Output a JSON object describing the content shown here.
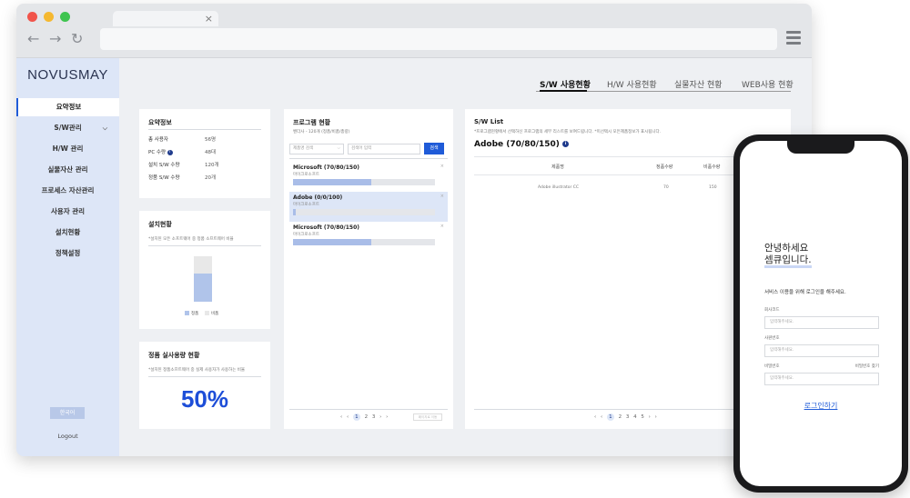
{
  "browser": {
    "tab_close": "×",
    "back": "←",
    "forward": "→",
    "reload": "↻"
  },
  "sidebar": {
    "logo": "NOVUSMAY",
    "items": [
      {
        "label": "요약정보"
      },
      {
        "label": "S/W관리"
      },
      {
        "label": "H/W 관리"
      },
      {
        "label": "실물자산 관리"
      },
      {
        "label": "프로세스 자산관리"
      },
      {
        "label": "사용자 관리"
      },
      {
        "label": "설치현황"
      },
      {
        "label": "정책설정"
      }
    ],
    "chevron": "⌵",
    "lang_button": "한국어",
    "logout": "Logout"
  },
  "top_tabs": [
    "S/W 사용현황",
    "H/W 사용현황",
    "실물자산 현황",
    "WEB사용 현황"
  ],
  "summary": {
    "title": "요약정보",
    "rows": [
      {
        "label": "총 사용자",
        "value": "56명"
      },
      {
        "label": "PC 수량",
        "value": "48대"
      },
      {
        "label": "설치 S/W 수량",
        "value": "120개"
      },
      {
        "label": "정품 S/W 수량",
        "value": "20개"
      }
    ],
    "info": "i"
  },
  "install": {
    "title": "설치현황",
    "subtitle": "*설치된 모든 소프트웨어 중 정품 소프트웨어 비율",
    "legend_genuine": "정품",
    "legend_other": "비품",
    "genuine_ratio": 0.62
  },
  "usage": {
    "title": "정품 실사용량 현황",
    "subtitle": "*설치된 정품소프트웨어 중 실제 사용자가 사용하는 비율",
    "percent": "50%"
  },
  "program": {
    "title": "프로그램 현황",
    "subtitle": "벤더사 - 120개 (정품/비품/총량)",
    "select_placeholder": "제품명 검색",
    "search_placeholder": "검색어 입력",
    "search_button": "검색",
    "items": [
      {
        "name": "Microsoft (70/80/150)",
        "vendor": "마이크로소프트",
        "fill": 0.55
      },
      {
        "name": "Adobe (0/0/100)",
        "vendor": "마이크로소프트",
        "fill": 0.02
      },
      {
        "name": "Microsoft (70/80/150)",
        "vendor": "마이크로소프트",
        "fill": 0.55
      }
    ],
    "pager": [
      "‹",
      "‹",
      "1",
      "2",
      "3",
      "›",
      "›"
    ],
    "goto_placeholder": "페이지로 이동"
  },
  "swlist": {
    "title": "S/W List",
    "subtitle": "*프로그램현황에서 선택하신 프로그램의 세부 리스트를 보여드립니다.    *미선택시 모든제품정보가 표시됩니다.",
    "heading": "Adobe (70/80/150)",
    "headers": [
      "제품명",
      "정품수량",
      "비품수량"
    ],
    "row": [
      "Adobe illustrator CC",
      "70",
      "150"
    ],
    "pager": [
      "‹",
      "‹",
      "1",
      "2",
      "3",
      "4",
      "5",
      "›",
      "›"
    ]
  },
  "phone": {
    "greeting_1": "안녕하세요",
    "greeting_2": "셈큐입니다.",
    "desc": "서비스 이용을 위해 로그인을 해주세요.",
    "field1_label": "회사코드",
    "field1_placeholder": "입력해주세요.",
    "field2_label": "사원번호",
    "field2_placeholder": "입력해주세요.",
    "field3_label": "비밀번호",
    "field3_placeholder": "입력해주세요.",
    "find_password": "비밀번호 찾기",
    "login": "로그인하기"
  }
}
